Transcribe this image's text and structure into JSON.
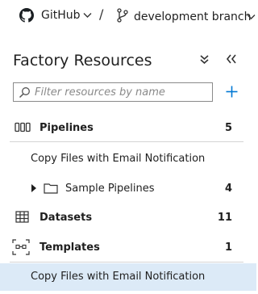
{
  "header": {
    "repo_label": "GitHub",
    "separator": "/",
    "branch_label": "development branch"
  },
  "panel": {
    "title": "Factory Resources",
    "filter_placeholder": "Filter resources by name"
  },
  "tree": {
    "pipelines": {
      "label": "Pipelines",
      "count": "5"
    },
    "pipeline_item": {
      "label": "Copy Files with Email Notification"
    },
    "folder": {
      "label": "Sample Pipelines",
      "count": "4"
    },
    "datasets": {
      "label": "Datasets",
      "count": "11"
    },
    "templates": {
      "label": "Templates",
      "count": "1"
    },
    "template_item": {
      "label": "Copy Files with Email Notification"
    }
  },
  "colors": {
    "selected_bg": "#dceaf7",
    "accent": "#0078d4"
  },
  "icons": [
    "github-icon",
    "chevron-down-icon",
    "branch-icon",
    "collapse-all-icon",
    "hide-panel-icon",
    "search-icon",
    "plus-icon",
    "pipeline-icon",
    "caret-right-icon",
    "folder-icon",
    "dataset-icon",
    "template-icon"
  ]
}
